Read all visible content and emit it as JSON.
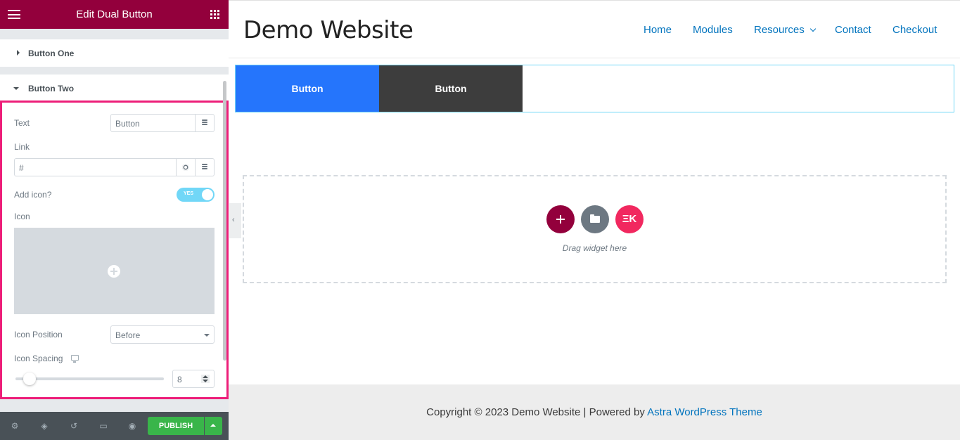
{
  "panel": {
    "title": "Edit Dual Button",
    "sections": {
      "button_one": "Button One",
      "button_two": "Button Two"
    },
    "controls": {
      "text": {
        "label": "Text",
        "value": "Button"
      },
      "link": {
        "label": "Link",
        "value": "#"
      },
      "add_icon": {
        "label": "Add icon?",
        "toggle_label": "YES",
        "checked": true
      },
      "icon": {
        "label": "Icon"
      },
      "icon_position": {
        "label": "Icon Position",
        "value": "Before"
      },
      "icon_spacing": {
        "label": "Icon Spacing",
        "value": "8",
        "slider_fraction": 0.08
      }
    },
    "footer": {
      "publish_label": "PUBLISH",
      "icons": [
        "settings-icon",
        "layers-icon",
        "history-icon",
        "responsive-icon",
        "preview-eye-icon"
      ]
    },
    "highlight_color": "#ed1e79",
    "header_color": "#93003c"
  },
  "site": {
    "title": "Demo Website",
    "nav": [
      "Home",
      "Modules",
      "Resources",
      "Contact",
      "Checkout"
    ],
    "dual_button": {
      "one": {
        "label": "Button",
        "color": "#2575fc"
      },
      "two": {
        "label": "Button",
        "color": "#3d3d3d"
      }
    },
    "drop_zone": {
      "text": "Drag widget here"
    },
    "footer": {
      "prefix": "Copyright © 2023 Demo Website | Powered by ",
      "link": "Astra WordPress Theme"
    }
  }
}
